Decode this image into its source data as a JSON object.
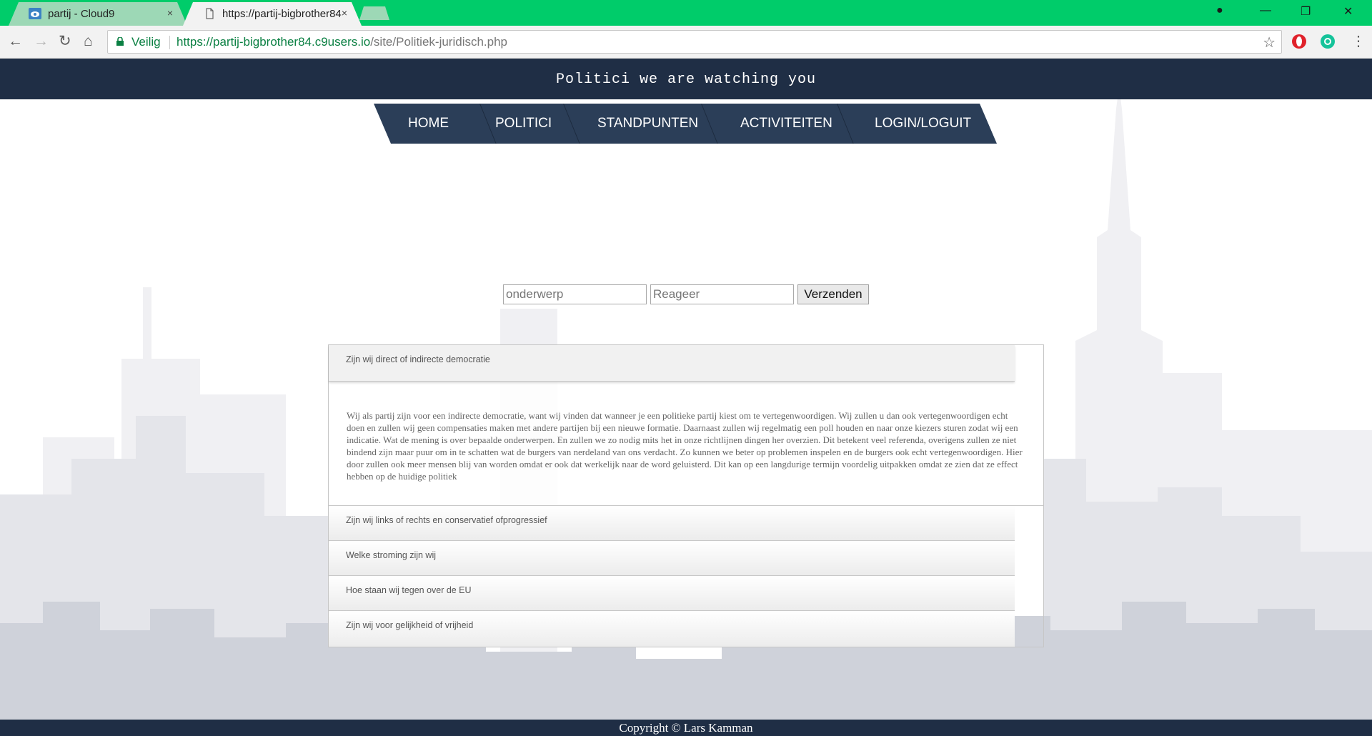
{
  "browser": {
    "tabs": [
      {
        "title": "partij - Cloud9",
        "close": "×"
      },
      {
        "title": "https://partij-bigbrother84",
        "close": "×"
      }
    ],
    "window_controls": {
      "account": "●",
      "minimize": "—",
      "restore": "❐",
      "close": "✕"
    },
    "nav": {
      "back": "←",
      "forward": "→",
      "reload": "↻",
      "home": "⌂"
    },
    "address_bar": {
      "secure_label": "Veilig",
      "url_scheme": "https://",
      "url_host": "partij-bigbrother84.c9users.io",
      "url_path": "/site/Politiek-juridisch.php",
      "bookmark": "☆"
    },
    "colors": {
      "tabbar": "#00cc6a",
      "secure": "#0b8043"
    }
  },
  "site": {
    "header_title": "Politici we are watching you",
    "menu": [
      {
        "label": "HOME"
      },
      {
        "label": "POLITICI"
      },
      {
        "label": "STANDPUNTEN"
      },
      {
        "label": "ACTIVITEITEN"
      },
      {
        "label": "LOGIN/LOGUIT"
      }
    ],
    "form": {
      "subject_placeholder": "onderwerp",
      "reaction_placeholder": "Reageer",
      "submit_label": "Verzenden"
    },
    "accordion": [
      {
        "title": "Zijn wij direct of indirecte democratie",
        "expanded": true,
        "body": "Wij als partij zijn voor een indirecte democratie, want wij vinden dat wanneer je een politieke partij kiest om te vertegenwoordigen. Wij zullen u dan ook vertegenwoordigen echt doen en zullen wij geen compensaties maken met andere partijen bij een nieuwe formatie. Daarnaast zullen wij regelmatig een poll houden en naar onze kiezers sturen zodat wij een indicatie. Wat de mening is over bepaalde onderwerpen. En zullen we zo nodig mits het in onze richtlijnen dingen her overzien. Dit betekent veel referenda, overigens zullen ze niet bindend zijn maar puur om in te schatten wat de burgers van nerdeland van ons verdacht. Zo kunnen we beter op problemen inspelen en de burgers ook echt vertegenwoordigen. Hier door zullen ook meer mensen blij van worden omdat er ook dat werkelijk naar de word geluisterd. Dit kan op een langdurige termijn voordelig uitpakken omdat ze zien dat ze effect hebben op de huidige politiek"
      },
      {
        "title": "Zijn wij links of rechts en conservatief ofprogressief",
        "expanded": false
      },
      {
        "title": "Welke stroming zijn wij",
        "expanded": false
      },
      {
        "title": "Hoe staan wij tegen over de EU",
        "expanded": false
      },
      {
        "title": "Zijn wij voor gelijkheid of vrijheid",
        "expanded": false
      }
    ],
    "footer": "Copyright © Lars Kamman",
    "colors": {
      "header": "#1f2e45",
      "menu": "#2b3e58"
    }
  }
}
